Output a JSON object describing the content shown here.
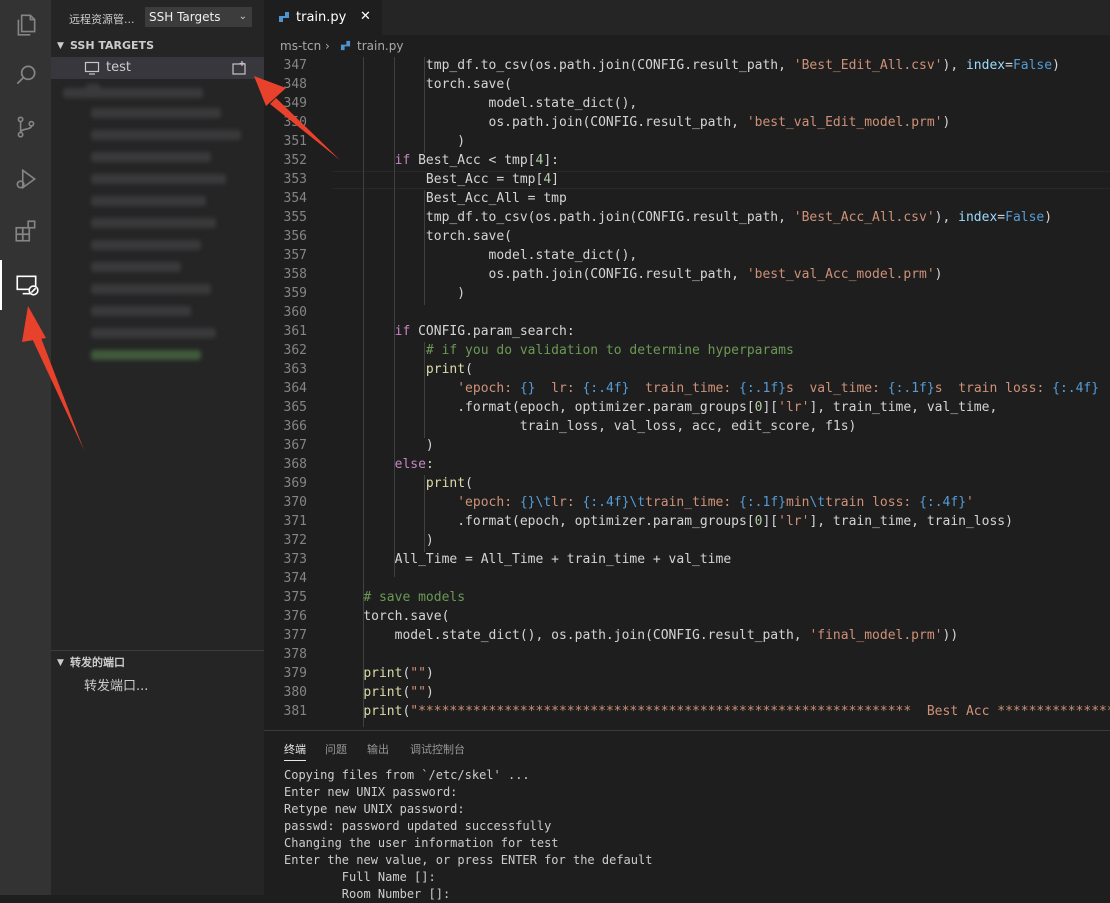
{
  "sidebar": {
    "title": "远程资源管...",
    "target_select": "SSH Targets",
    "section_label": "SSH TARGETS",
    "host_label": "test",
    "ports_section": "转发的端口",
    "ports_item": "转发端口..."
  },
  "editor": {
    "tab_label": "train.py",
    "breadcrumb_folder": "ms-tcn",
    "breadcrumb_file": "train.py"
  },
  "code_lines": [
    {
      "n": "347",
      "t": "            tmp_df.to_csv(os.path.join(CONFIG.result_path, 'Best_Edit_All.csv'), index=False)"
    },
    {
      "n": "348",
      "t": "            torch.save("
    },
    {
      "n": "349",
      "t": "                    model.state_dict(),"
    },
    {
      "n": "350",
      "t": "                    os.path.join(CONFIG.result_path, 'best_val_Edit_model.prm')"
    },
    {
      "n": "351",
      "t": "                )"
    },
    {
      "n": "352",
      "t": "        if Best_Acc < tmp[4]:"
    },
    {
      "n": "353",
      "t": "            Best_Acc = tmp[4]"
    },
    {
      "n": "354",
      "t": "            Best_Acc_All = tmp"
    },
    {
      "n": "355",
      "t": "            tmp_df.to_csv(os.path.join(CONFIG.result_path, 'Best_Acc_All.csv'), index=False)"
    },
    {
      "n": "356",
      "t": "            torch.save("
    },
    {
      "n": "357",
      "t": "                    model.state_dict(),"
    },
    {
      "n": "358",
      "t": "                    os.path.join(CONFIG.result_path, 'best_val_Acc_model.prm')"
    },
    {
      "n": "359",
      "t": "                )"
    },
    {
      "n": "360",
      "t": ""
    },
    {
      "n": "361",
      "t": "        if CONFIG.param_search:"
    },
    {
      "n": "362",
      "t": "            # if you do validation to determine hyperparams"
    },
    {
      "n": "363",
      "t": "            print("
    },
    {
      "n": "364",
      "t": "                'epoch: {}  lr: {:.4f}  train_time: {:.1f}s  val_time: {:.1f}s  train loss: {:.4f}  v"
    },
    {
      "n": "365",
      "t": "                .format(epoch, optimizer.param_groups[0]['lr'], train_time, val_time,"
    },
    {
      "n": "366",
      "t": "                        train_loss, val_loss, acc, edit_score, f1s)"
    },
    {
      "n": "367",
      "t": "            )"
    },
    {
      "n": "368",
      "t": "        else:"
    },
    {
      "n": "369",
      "t": "            print("
    },
    {
      "n": "370",
      "t": "                'epoch: {}\\tlr: {:.4f}\\ttrain_time: {:.1f}min\\ttrain loss: {:.4f}'"
    },
    {
      "n": "371",
      "t": "                .format(epoch, optimizer.param_groups[0]['lr'], train_time, train_loss)"
    },
    {
      "n": "372",
      "t": "            )"
    },
    {
      "n": "373",
      "t": "        All_Time = All_Time + train_time + val_time"
    },
    {
      "n": "374",
      "t": ""
    },
    {
      "n": "375",
      "t": "    # save models"
    },
    {
      "n": "376",
      "t": "    torch.save("
    },
    {
      "n": "377",
      "t": "        model.state_dict(), os.path.join(CONFIG.result_path, 'final_model.prm'))"
    },
    {
      "n": "378",
      "t": ""
    },
    {
      "n": "379",
      "t": "    print(\"\")"
    },
    {
      "n": "380",
      "t": "    print(\"\")"
    },
    {
      "n": "381",
      "t": "    print(\"***************************************************************  Best Acc *****************"
    }
  ],
  "panel": {
    "tabs": [
      "终端",
      "问题",
      "输出",
      "调试控制台"
    ],
    "terminal_lines": [
      "Copying files from `/etc/skel' ...",
      "Enter new UNIX password:",
      "Retype new UNIX password:",
      "passwd: password updated successfully",
      "Changing the user information for test",
      "Enter the new value, or press ENTER for the default",
      "        Full Name []:",
      "        Room Number []:"
    ]
  },
  "icons": {
    "explorer": "files-icon",
    "search": "search-icon",
    "scm": "source-control-icon",
    "debug": "run-debug-icon",
    "extensions": "extensions-icon",
    "remote": "remote-explorer-icon"
  },
  "colors": {
    "annotation_arrow": "#e8412c",
    "keyword": "#c586c0",
    "string": "#ce9178",
    "comment": "#6a9955"
  }
}
